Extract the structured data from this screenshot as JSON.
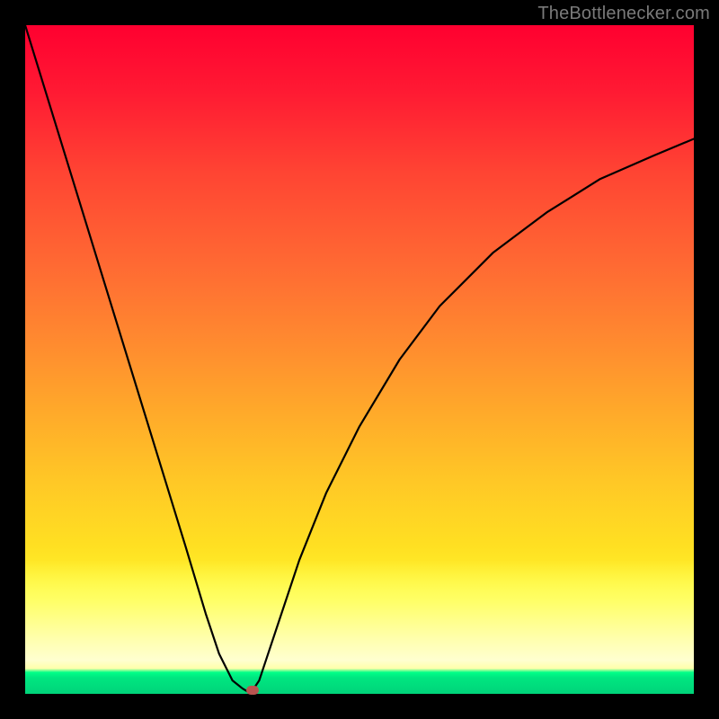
{
  "watermark": "TheBottlenecker.com",
  "chart_data": {
    "type": "line",
    "title": "",
    "xlabel": "",
    "ylabel": "",
    "xlim": [
      0,
      100
    ],
    "ylim": [
      0,
      100
    ],
    "x": [
      0,
      4,
      8,
      12,
      16,
      20,
      24,
      27,
      29,
      31,
      32.5,
      33.5,
      34,
      35,
      36,
      38,
      41,
      45,
      50,
      56,
      62,
      70,
      78,
      86,
      94,
      100
    ],
    "values": [
      100,
      87,
      74,
      61,
      48,
      35,
      22,
      12,
      6,
      2,
      0.8,
      0.2,
      0.5,
      2,
      5,
      11,
      20,
      30,
      40,
      50,
      58,
      66,
      72,
      77,
      80.5,
      83
    ],
    "marker": {
      "x": 34,
      "y": 0.5
    },
    "gradient_stops": [
      {
        "pos": 0.0,
        "color": "#ff0030"
      },
      {
        "pos": 0.48,
        "color": "#ff8c2f"
      },
      {
        "pos": 0.88,
        "color": "#ffff33"
      },
      {
        "pos": 0.93,
        "color": "#ffffc0"
      },
      {
        "pos": 0.97,
        "color": "#00ff88"
      },
      {
        "pos": 1.0,
        "color": "#00d47a"
      }
    ]
  }
}
